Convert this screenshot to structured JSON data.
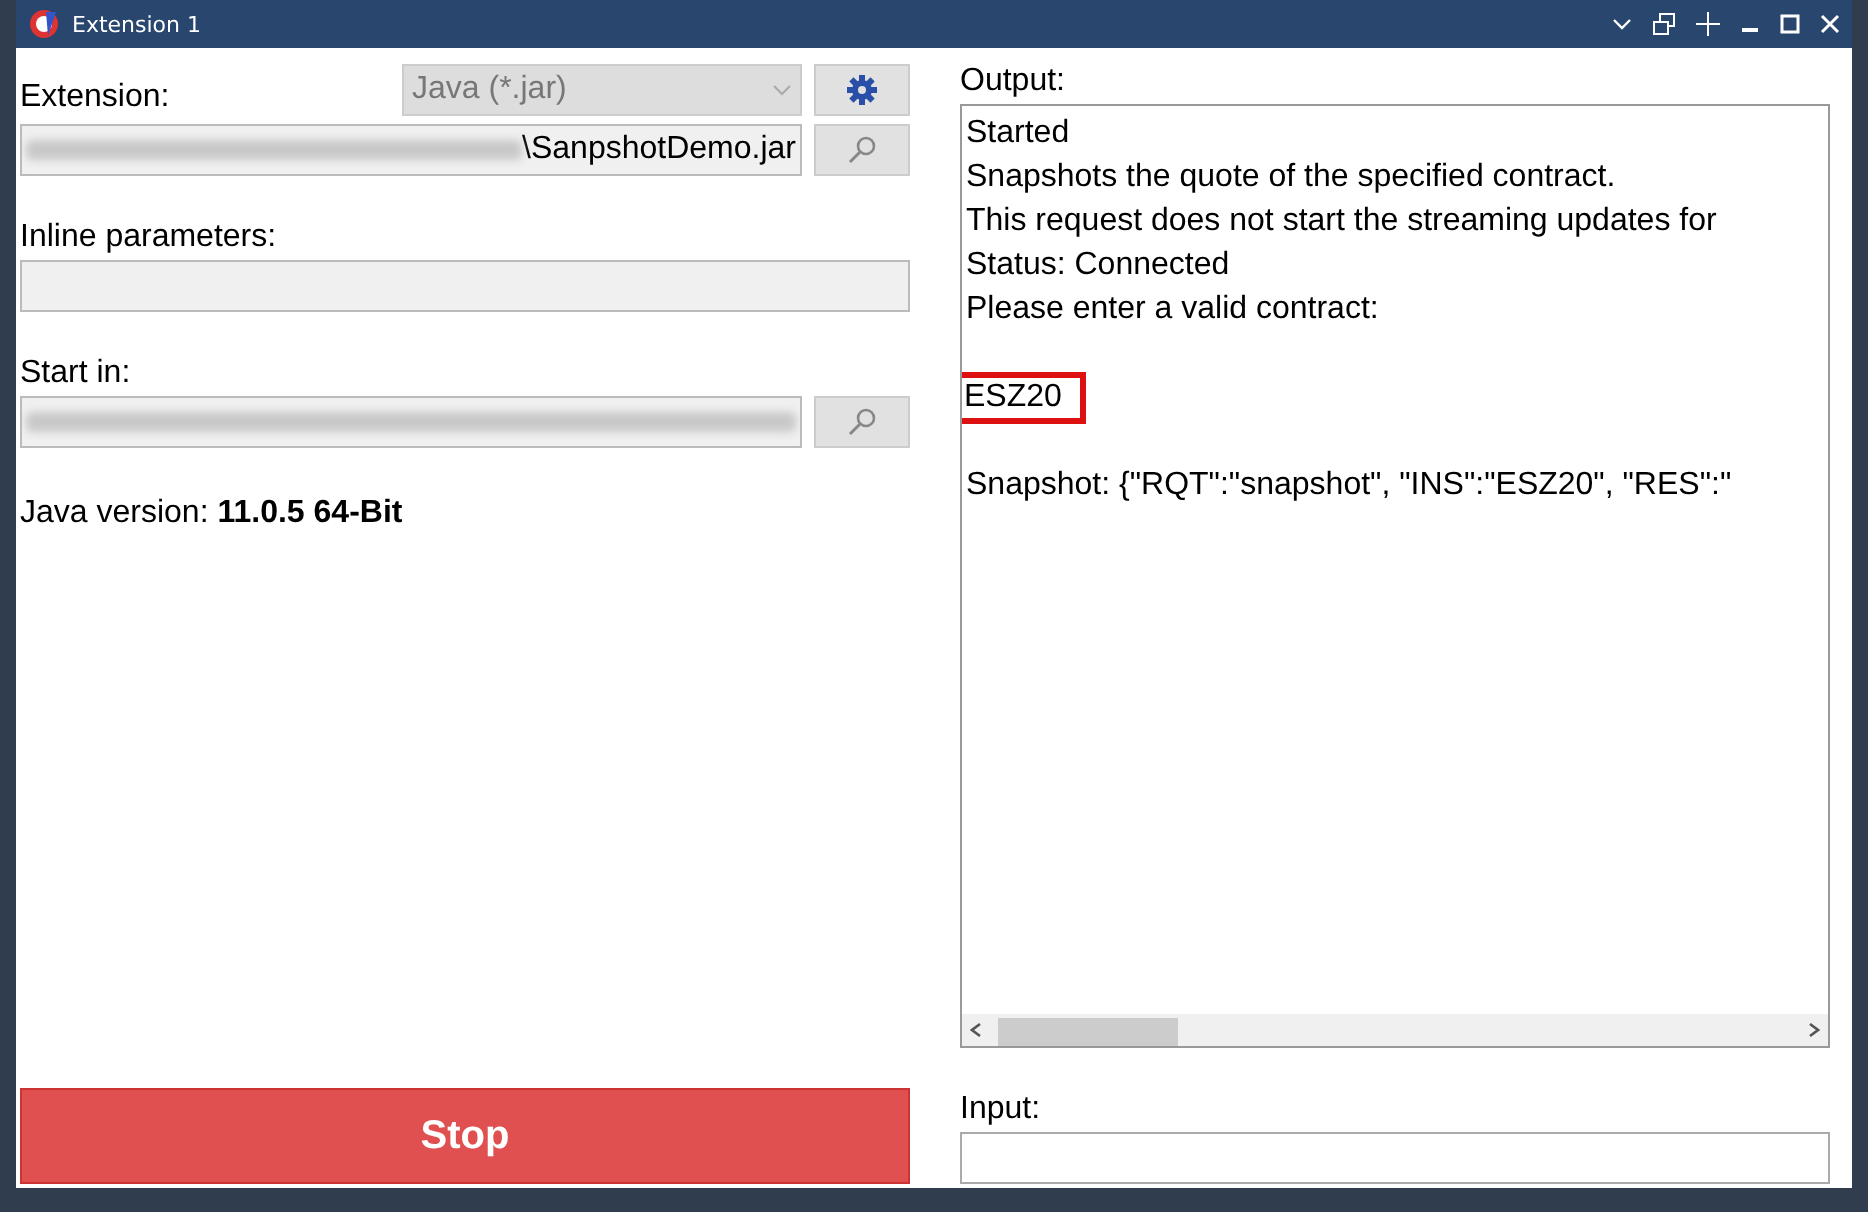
{
  "window": {
    "title": "Extension 1"
  },
  "extension": {
    "label": "Extension:",
    "select_value": "Java (*.jar)",
    "select_disabled": true
  },
  "path_field": {
    "value": "\\SanpshotDemo.jar",
    "blurred_prefix": true
  },
  "inline_parameters": {
    "label": "Inline parameters:"
  },
  "start_in": {
    "label": "Start in:",
    "blurred": true
  },
  "java_version": {
    "label": "Java version:",
    "value": "11.0.5 64-Bit"
  },
  "output": {
    "label": "Output:",
    "blocks": [
      {
        "lines": [
          {
            "text": "Started",
            "highlighted": false
          },
          {
            "text": "Snapshots the quote of the specified contract.",
            "highlighted": false
          },
          {
            "text": "This request does not start the streaming updates for",
            "highlighted": false
          },
          {
            "text": "Status: Connected",
            "highlighted": false
          },
          {
            "text": "Please enter a valid contract:",
            "highlighted": false
          }
        ]
      },
      {
        "lines": [
          {
            "text": "ESZ20",
            "highlighted": true
          }
        ]
      },
      {
        "lines": [
          {
            "text": "Snapshot: {\"RQT\":\"snapshot\", \"INS\":\"ESZ20\", \"RES\":\"",
            "highlighted": false
          }
        ]
      }
    ]
  },
  "stop_button": {
    "label": "Stop"
  },
  "input": {
    "label": "Input:"
  }
}
